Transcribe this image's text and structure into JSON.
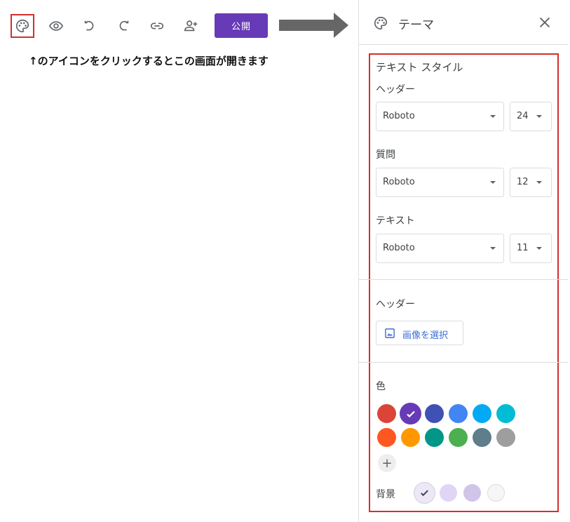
{
  "toolbar": {
    "publish_label": "公開",
    "icons": [
      "palette-icon",
      "eye-icon",
      "undo-icon",
      "redo-icon",
      "link-icon",
      "add-person-icon"
    ]
  },
  "instruction": "↑のアイコンをクリックするとこの画面が開きます",
  "panel": {
    "title": "テーマ",
    "text_style_title": "テキスト スタイル",
    "header_label": "ヘッダー",
    "header_font": "Roboto",
    "header_size": "24",
    "question_label": "質問",
    "question_font": "Roboto",
    "question_size": "12",
    "text_label": "テキスト",
    "text_font": "Roboto",
    "text_size": "11",
    "header_section_label": "ヘッダー",
    "choose_image_label": "画像を選択",
    "color_label": "色",
    "add_color_label": "+",
    "background_label": "背景"
  },
  "colors": {
    "accent": "#673ab7",
    "highlight_border": "#d32f2f",
    "theme_colors": [
      "#db4437",
      "#673ab7",
      "#3f51b5",
      "#4285f4",
      "#03a9f4",
      "#00bcd4",
      "#ff5722",
      "#ff9800",
      "#009688",
      "#4caf50",
      "#607d8b",
      "#9e9e9e"
    ],
    "selected_theme_color": "#673ab7",
    "background_colors": [
      "#ede7f6",
      "#e1d5f5",
      "#d1c4e9",
      "#f6f6f6"
    ],
    "selected_background_color": "#ede7f6"
  }
}
